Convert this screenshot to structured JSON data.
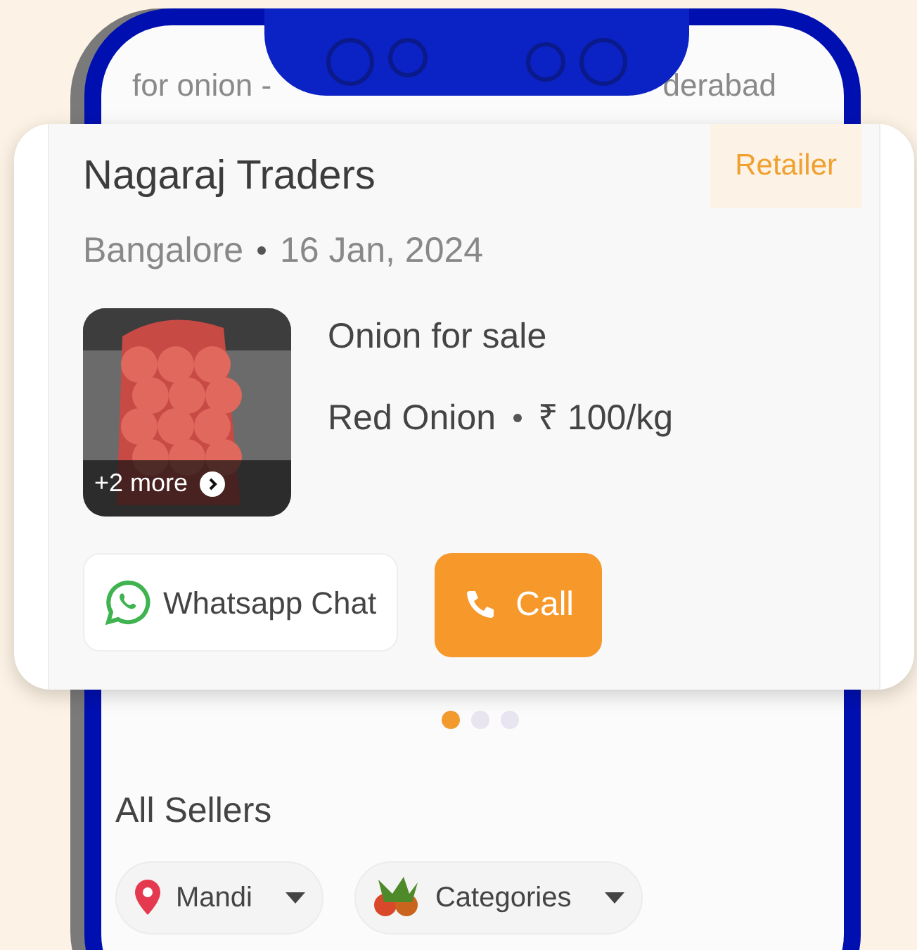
{
  "search_bar": {
    "text_left": "for onion -",
    "text_right": "derabad"
  },
  "listing": {
    "seller": "Nagaraj Traders",
    "badge": "Retailer",
    "location": "Bangalore",
    "date": "16 Jan, 2024",
    "photo": {
      "kind": "picture",
      "more": "+2 more"
    },
    "title": "Onion for sale",
    "variety": "Red Onion",
    "price": "₹ 100/kg",
    "buttons": [
      {
        "kind": "whatsapp",
        "label": "Whatsapp Chat"
      },
      {
        "kind": "call",
        "label": "Call"
      }
    ]
  },
  "carousel_dots": [
    {
      "selected": true
    },
    {
      "selected": false
    },
    {
      "selected": false
    }
  ],
  "section_title": "All Sellers",
  "filters": [
    {
      "kind": "location",
      "label": "Mandi"
    },
    {
      "kind": "category",
      "label": "Categories"
    }
  ]
}
